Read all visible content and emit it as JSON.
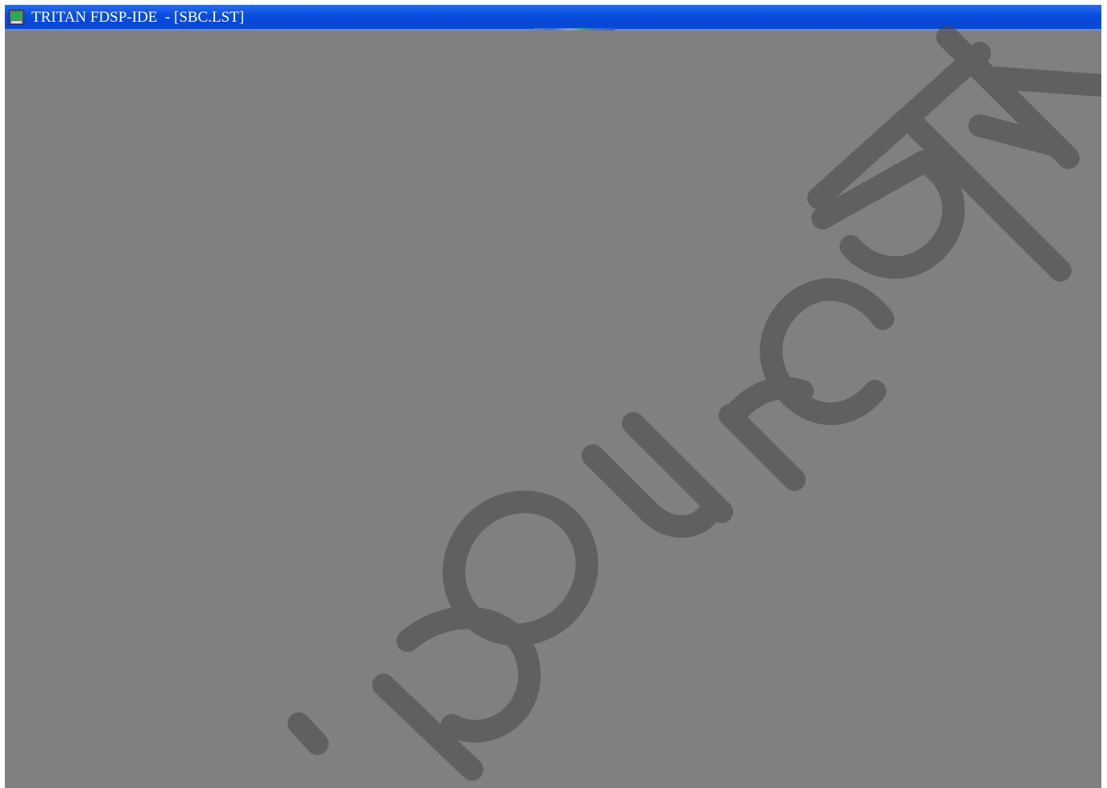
{
  "window": {
    "title": "TRITAN FDSP-IDE  - [SBC.LST]",
    "icon": "app-icon"
  },
  "colors": {
    "titlebar": "#0a4fe0",
    "workspace": "#808080",
    "watermark": "#444444"
  }
}
